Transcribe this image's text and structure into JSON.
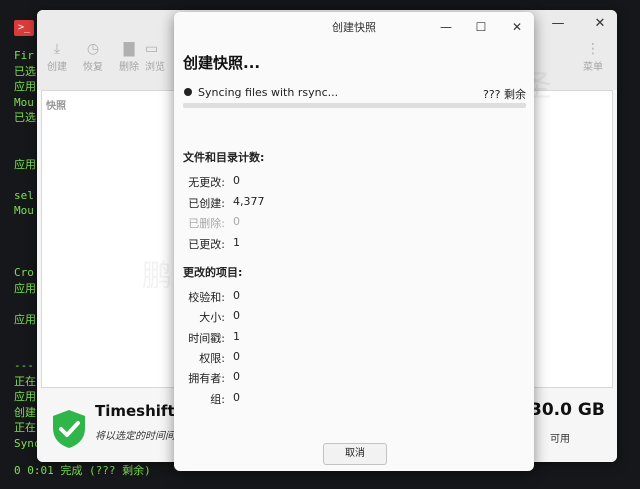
{
  "terminal": {
    "tab_icon": ">_",
    "lines": [
      "Fir",
      "已选",
      "应用",
      "Mou",
      "已选",
      "",
      "",
      "应用",
      "",
      "sel",
      "Mou",
      "",
      "",
      "",
      "Cro",
      "应用",
      "",
      "应用",
      "",
      "",
      "---",
      "正在",
      "应用",
      "创建",
      "正在",
      "Sync"
    ],
    "bottom_line": "0 0:01 完成 (??? 剩余)"
  },
  "timeshift": {
    "toolbar": {
      "create": "创建",
      "restore": "恢复",
      "delete": "删除",
      "browse": "浏览",
      "menu": "菜单"
    },
    "list_header": "快照",
    "footer": {
      "name": "Timeshift已",
      "description": "将以选定的时间间",
      "size": "30.0 GB",
      "available": "可用"
    }
  },
  "dialog": {
    "title": "创建快照",
    "heading": "创建快照...",
    "status": "Syncing files with rsync...",
    "remaining": "??? 剩余",
    "progress": 0.0,
    "counts_title": "文件和目录计数:",
    "counts": [
      {
        "label": "无更改:",
        "value": "0",
        "dim": false
      },
      {
        "label": "已创建:",
        "value": "4,377",
        "dim": false
      },
      {
        "label": "已删除:",
        "value": "0",
        "dim": true
      },
      {
        "label": "已更改:",
        "value": "1",
        "dim": false
      }
    ],
    "changes_title": "更改的项目:",
    "changes": [
      {
        "label": "校验和:",
        "value": "0"
      },
      {
        "label": "大小:",
        "value": "0"
      },
      {
        "label": "时间戳:",
        "value": "1"
      },
      {
        "label": "权限:",
        "value": "0"
      },
      {
        "label": "拥有者:",
        "value": "0"
      },
      {
        "label": "组:",
        "value": "0"
      }
    ],
    "cancel": "取消"
  },
  "colors": {
    "terminal_text": "#7ee04f",
    "progress": "#6a8fbf",
    "shield": "#2fb54a"
  },
  "icons": [
    "terminal-icon",
    "create-icon",
    "restore-icon",
    "delete-icon",
    "browse-icon",
    "menu-icon",
    "shield-check-icon",
    "minimize-icon",
    "maximize-icon",
    "close-icon"
  ]
}
